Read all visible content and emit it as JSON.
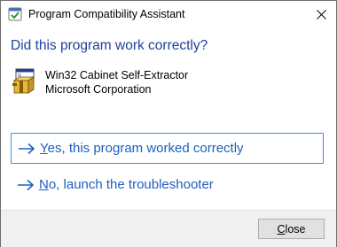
{
  "window": {
    "title": "Program Compatibility Assistant",
    "close_glyph": "close-icon",
    "title_icon": "compatibility-assistant-icon"
  },
  "main": {
    "heading": "Did this program work correctly?",
    "program": {
      "icon": "installer-box-icon",
      "name": "Win32 Cabinet Self-Extractor",
      "publisher": "Microsoft Corporation"
    },
    "options": [
      {
        "icon": "arrow-right-icon",
        "mnemonic": "Y",
        "label_rest": "es, this program worked correctly"
      },
      {
        "icon": "arrow-right-icon",
        "mnemonic": "N",
        "label_rest": "o, launch the troubleshooter"
      }
    ]
  },
  "footer": {
    "close_mnemonic": "C",
    "close_rest": "lose"
  },
  "colors": {
    "heading": "#1f3f9d",
    "link": "#1f5fbf",
    "focus_border": "#3d8ee6",
    "footer_bg": "#f0f0f0"
  }
}
